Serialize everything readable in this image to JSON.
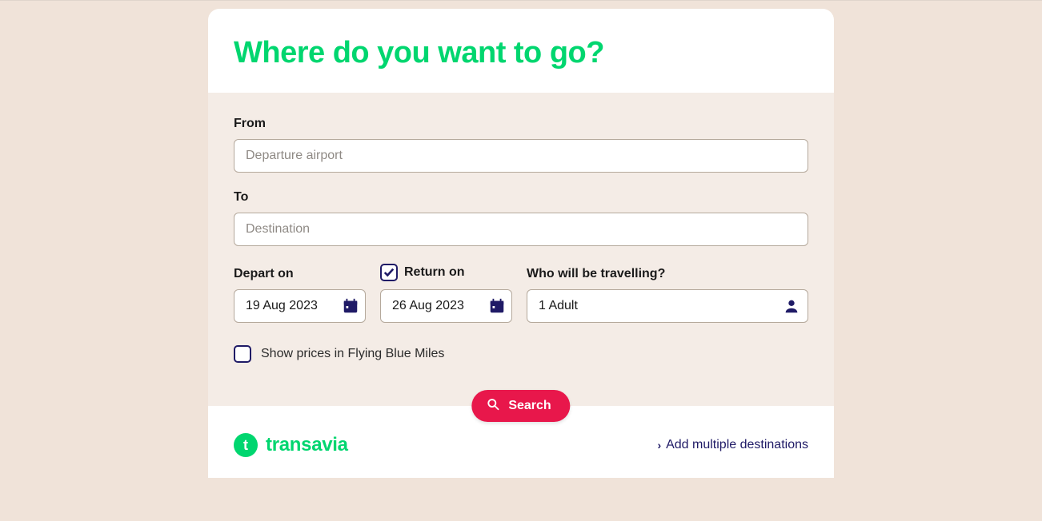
{
  "header": {
    "title": "Where do you want to go?"
  },
  "form": {
    "from_label": "From",
    "from_placeholder": "Departure airport",
    "from_value": "",
    "to_label": "To",
    "to_placeholder": "Destination",
    "to_value": "",
    "depart_label": "Depart on",
    "depart_value": "19 Aug 2023",
    "return_label": "Return on",
    "return_checked": true,
    "return_value": "26 Aug 2023",
    "passengers_label": "Who will be travelling?",
    "passengers_value": "1 Adult",
    "miles_label": "Show prices in Flying Blue Miles",
    "miles_checked": false
  },
  "actions": {
    "search_label": "Search",
    "multi_dest_label": "Add multiple destinations"
  },
  "brand": {
    "mark": "t",
    "name": "transavia"
  }
}
